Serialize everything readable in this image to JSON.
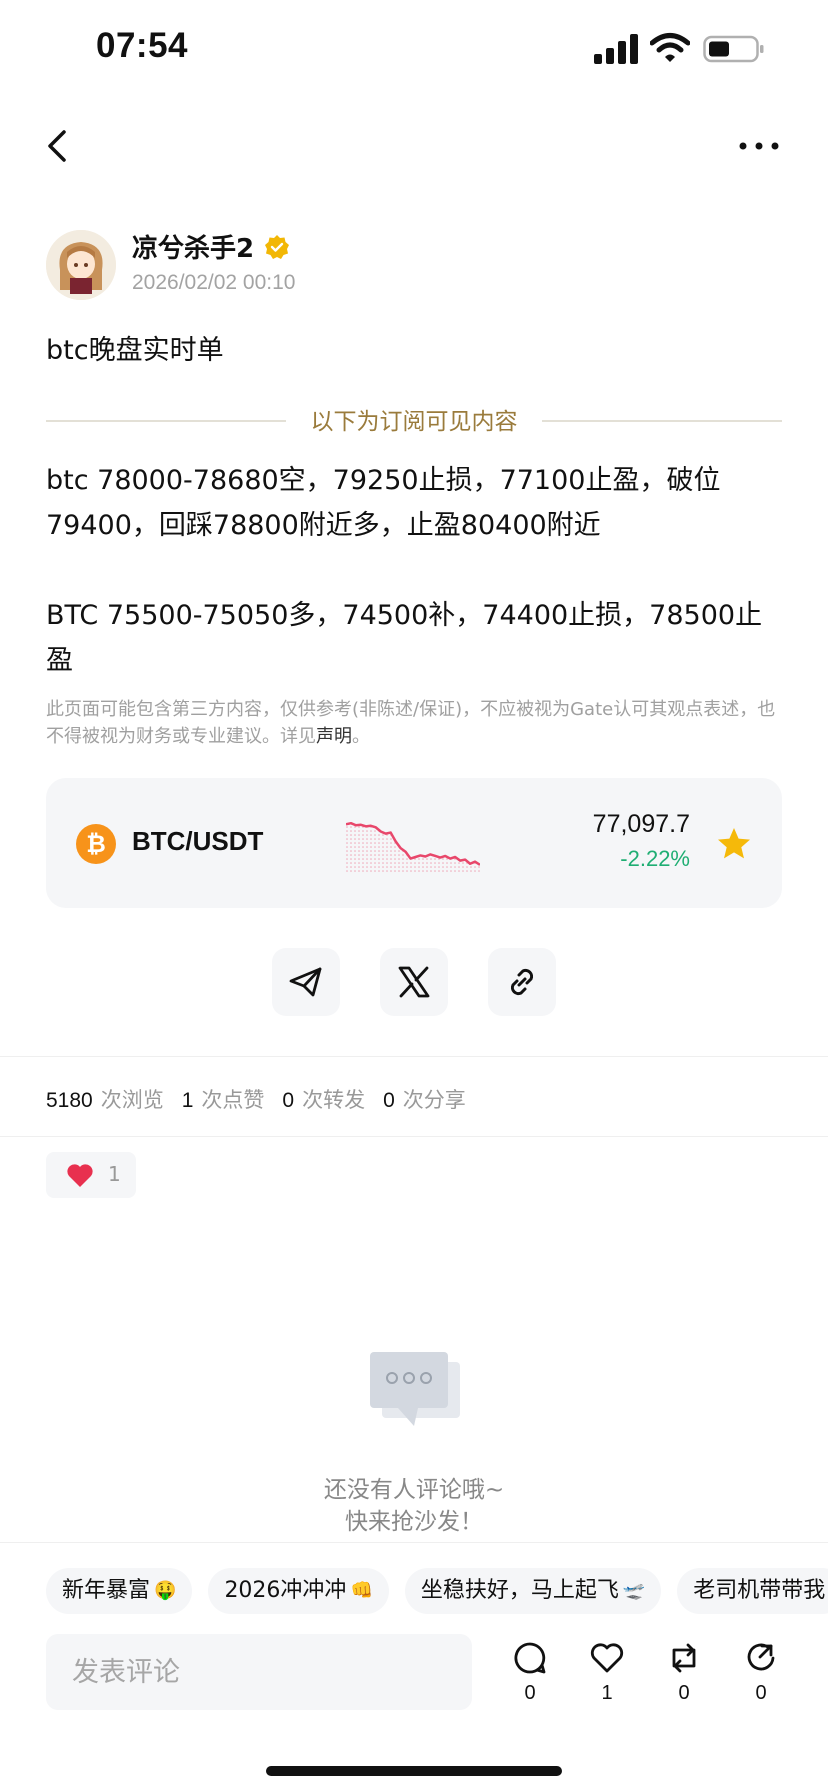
{
  "status_bar": {
    "time": "07:54"
  },
  "author": {
    "name": "凉兮杀手2",
    "time": "2026/02/02 00:10"
  },
  "post": {
    "title": "btc晚盘实时单",
    "subscription_divider": "以下为订阅可见内容",
    "body": "btc 78000-78680空，79250止损，77100止盈，破位79400，回踩78800附近多，止盈80400附近\n\nBTC 75500-75050多，74500补，74400止损，78500止盈",
    "disclaimer_text": "此页面可能包含第三方内容，仅供参考(非陈述/保证)，不应被视为Gate认可其观点表述，也不得被视为财务或专业建议。详见",
    "disclaimer_link": "声明",
    "disclaimer_end": "。"
  },
  "ticker": {
    "pair": "BTC/USDT",
    "price": "77,097.7",
    "change": "-2.22%",
    "sparkline": [
      0.88,
      0.9,
      0.86,
      0.87,
      0.84,
      0.85,
      0.82,
      0.74,
      0.7,
      0.72,
      0.55,
      0.42,
      0.35,
      0.22,
      0.25,
      0.28,
      0.26,
      0.3,
      0.27,
      0.24,
      0.27,
      0.22,
      0.25,
      0.18,
      0.2,
      0.12,
      0.16,
      0.1
    ],
    "colors": {
      "down": "#e8476b",
      "up": "#1fae73",
      "coin": "#f7931a",
      "star": "#f5b90a"
    }
  },
  "stats": [
    {
      "num": "5180",
      "label": "次浏览"
    },
    {
      "num": "1",
      "label": "次点赞"
    },
    {
      "num": "0",
      "label": "次转发"
    },
    {
      "num": "0",
      "label": "次分享"
    }
  ],
  "reaction": {
    "count": "1"
  },
  "empty_state": {
    "line1": "还没有人评论哦~",
    "line2": "快来抢沙发！"
  },
  "tags": [
    {
      "label": "新年暴富",
      "emoji": "🤑"
    },
    {
      "label": "2026冲冲冲",
      "emoji": "👊"
    },
    {
      "label": "坐稳扶好，马上起飞",
      "emoji": "🛫"
    },
    {
      "label": "老司机带带我",
      "emoji": ""
    }
  ],
  "comment": {
    "placeholder": "发表评论"
  },
  "actions": {
    "comment": "0",
    "like": "1",
    "repost": "0",
    "share": "0"
  }
}
